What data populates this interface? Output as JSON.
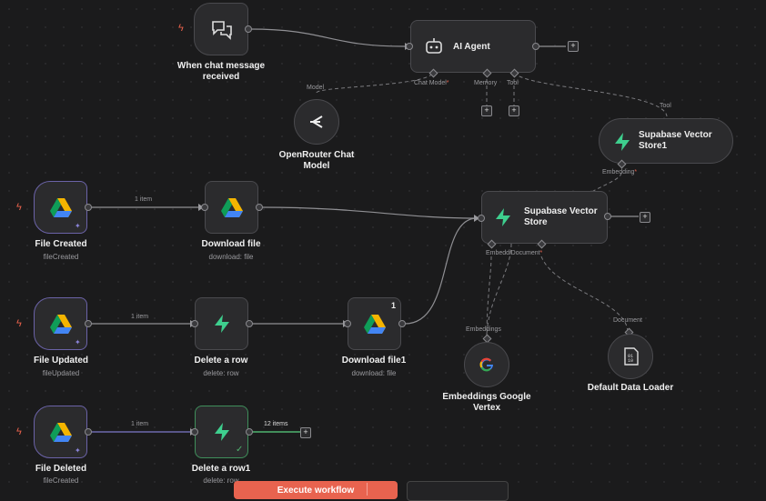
{
  "nodes": {
    "chat_trigger": {
      "label": "When chat message received"
    },
    "ai_agent": {
      "label": "AI Agent",
      "ports": {
        "chat_model": "Chat Model",
        "memory": "Memory",
        "tool": "Tool"
      }
    },
    "openrouter": {
      "label": "OpenRouter Chat Model",
      "port": "Model"
    },
    "supabase_vs1": {
      "label": "Supabase Vector Store1",
      "port_top": "Tool",
      "port_bottom": "Embedding"
    },
    "file_created": {
      "label": "File Created",
      "sub": "fileCreated"
    },
    "download_file": {
      "label": "Download file",
      "sub": "download: file"
    },
    "supabase_vs": {
      "label": "Supabase Vector Store",
      "port_embedding": "Embeddi",
      "port_document": "Document"
    },
    "file_updated": {
      "label": "File Updated",
      "sub": "fileUpdated"
    },
    "delete_row": {
      "label": "Delete a row",
      "sub": "delete: row"
    },
    "download_file1": {
      "label": "Download file1",
      "sub": "download: file",
      "badge": "1"
    },
    "embeddings_google": {
      "label": "Embeddings Google Vertex",
      "port": "Embeddings"
    },
    "default_loader": {
      "label": "Default Data Loader",
      "port": "Document"
    },
    "file_deleted": {
      "label": "File Deleted",
      "sub": "fileCreated"
    },
    "delete_row1": {
      "label": "Delete a row1",
      "sub": "delete: row"
    }
  },
  "edges": {
    "e1": "1 item",
    "e2": "1 item",
    "e3": "1 item",
    "e4": "12 items"
  },
  "required_mark": "*",
  "toolbar": {
    "execute_label": "Execute workflow"
  },
  "colors": {
    "accent": "#e8634f",
    "supabase": "#3ecf8e",
    "trigger_border": "#6b63a8",
    "success": "#3f8f5b"
  }
}
